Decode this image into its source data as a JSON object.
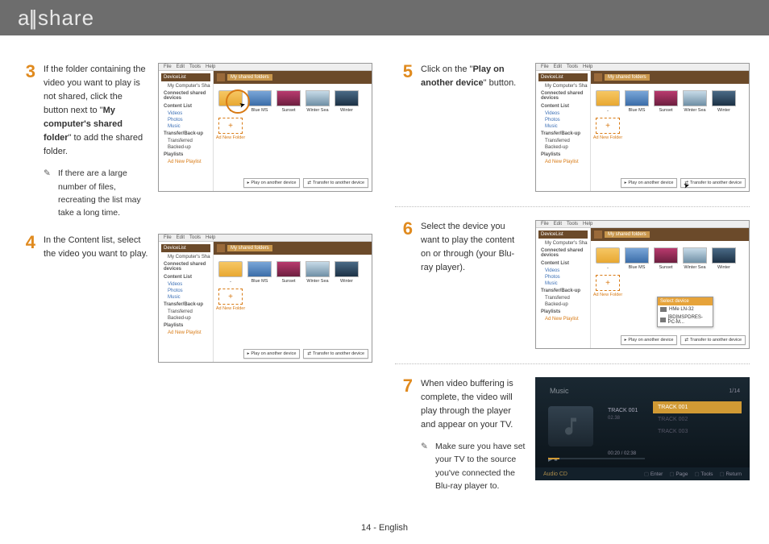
{
  "brand": "allshare",
  "footer": "14 - English",
  "menu": {
    "file": "File",
    "edit": "Edit",
    "tools": "Tools",
    "help": "Help"
  },
  "sidebar": {
    "devicelist": "DeviceList",
    "shared_folder": "My Computer's Shared Folder",
    "connected": "Connected shared devices",
    "contentlist": "Content List",
    "videos": "Videos",
    "photos": "Photos",
    "music": "Music",
    "backup": "Transfer/Back-up",
    "transferred": "Transferred",
    "backedup": "Backed-up",
    "playlists": "Playlists",
    "adnewplaylist": "Ad New Playlist"
  },
  "crumb": {
    "shared_folders": "My shared folders"
  },
  "thumbs": {
    "up": "..",
    "blue": "Blue MS",
    "sunset": "Sunset",
    "wintersea": "Winter Sea",
    "winter": "Winter",
    "new": "Ad New Folder"
  },
  "buttons": {
    "play_another": "Play on another device",
    "transfer": "Transfer to another device"
  },
  "device_popup": {
    "title": "Select device",
    "dev1": "HMe LN-32",
    "dev2": "[BD]MSPDRES-PC-M..."
  },
  "tv": {
    "header": "Music",
    "count": "1/14",
    "track": "TRACK 001",
    "sub": "02.38",
    "row1": "TRACK 001",
    "row2": "TRACK 002",
    "row3": "TRACK 003",
    "time": "00:20 / 02:38",
    "source": "Audio CD",
    "b_enter": "Enter",
    "b_page": "Page",
    "b_tools": "Tools",
    "b_return": "Return"
  },
  "steps": {
    "s3": {
      "num": "3",
      "text_before": "If the folder containing the video you want to play is not shared, click the button next to \"",
      "bold": "My computer's shared folder",
      "text_after": "\" to add the shared folder.",
      "note": "If there are a large number of files, recreating the list may take a long time."
    },
    "s4": {
      "num": "4",
      "text": "In the Content list, select the video you want to play."
    },
    "s5": {
      "num": "5",
      "text_before": "Click on the \"",
      "bold": "Play on another device",
      "text_after": "\" button."
    },
    "s6": {
      "num": "6",
      "text": "Select the device you want to play the content on or through (your Blu-ray player)."
    },
    "s7": {
      "num": "7",
      "text": "When video buffering is complete, the video will play through the player and appear on your TV.",
      "note": "Make sure you have set your TV to the source you've connected the Blu-ray player to."
    }
  }
}
